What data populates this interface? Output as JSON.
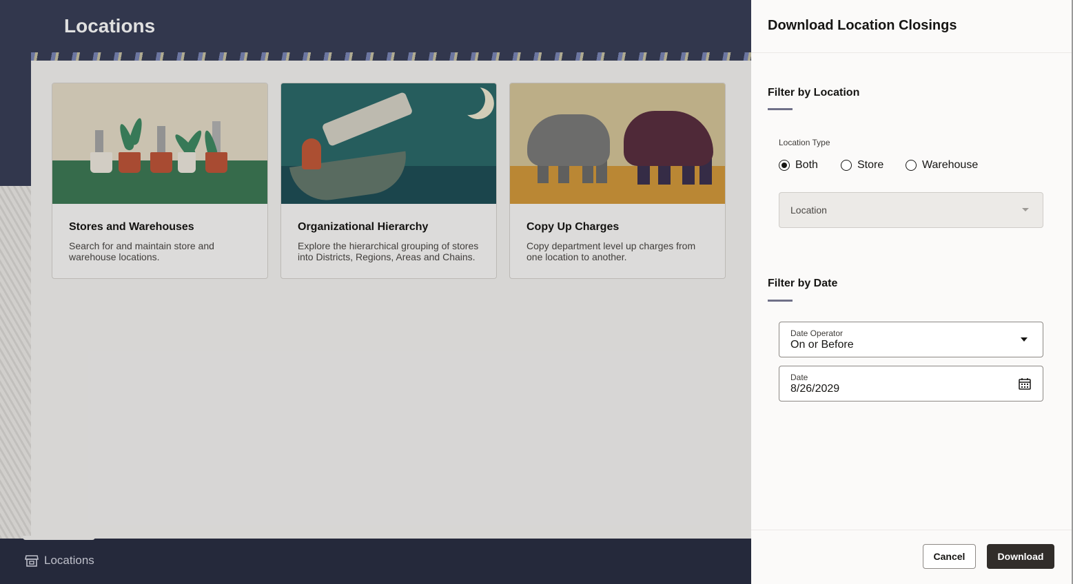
{
  "page": {
    "title": "Locations",
    "cards": [
      {
        "title": "Stores and Warehouses",
        "description": "Search for and maintain store and warehouse locations."
      },
      {
        "title": "Organizational Hierarchy",
        "description": "Explore the hierarchical grouping of stores into Districts, Regions, Areas and Chains."
      },
      {
        "title": "Copy Up Charges",
        "description": "Copy department level up charges from one location to another."
      }
    ],
    "footer": {
      "icon": "store-icon",
      "label": "Locations"
    }
  },
  "drawer": {
    "title": "Download Location Closings",
    "filter_location": {
      "title": "Filter by Location",
      "location_type_label": "Location Type",
      "options": [
        "Both",
        "Store",
        "Warehouse"
      ],
      "selected": "Both",
      "location_placeholder": "Location"
    },
    "filter_date": {
      "title": "Filter by Date",
      "date_operator_label": "Date Operator",
      "date_operator_value": "On or Before",
      "date_label": "Date",
      "date_value": "8/26/2029"
    },
    "buttons": {
      "cancel": "Cancel",
      "download": "Download"
    }
  },
  "colors": {
    "hero": "#3a3f58",
    "footer": "#2b2f44",
    "primary_button": "#312d2a",
    "section_accent": "#6f7088"
  }
}
